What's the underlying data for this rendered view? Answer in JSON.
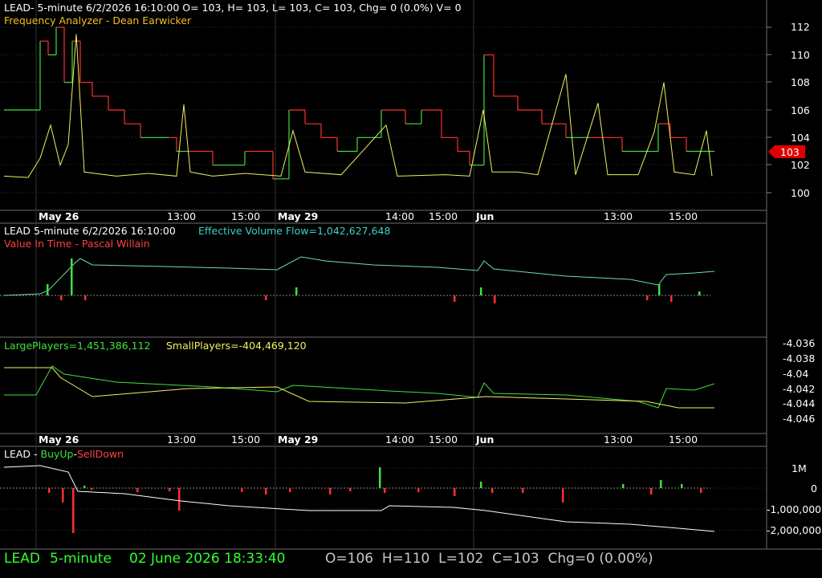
{
  "colors": {
    "background": "#000000",
    "frame": "#6e6e6e",
    "grid": "#3a3a3a",
    "text": "#ffffff",
    "title_orange": "#f0c020",
    "title_red": "#ff4040",
    "cyan": "#40d0c0",
    "green": "#40e040",
    "bright_green": "#30ff30",
    "red": "#ff3030",
    "yellow": "#f0f060",
    "mint": "#70e0a0",
    "marker_red": "#e00000"
  },
  "pane1": {
    "title": "LEAD- 5-minute 6/2/2026 16:10:00 O= 103, H= 103, L= 103, C= 103, Chg= 0 (0.0%) V= 0",
    "subtitle": "Frequency Analyzer - Dean Earwicker",
    "y_ticks": [
      "112",
      "110",
      "108",
      "106",
      "104",
      "102",
      "100"
    ],
    "last_price": "103"
  },
  "date_axis": {
    "labels": [
      "May 26",
      "13:00",
      "15:00",
      "May 29",
      "14:00",
      "15:00",
      "Jun",
      "13:00",
      "15:00"
    ]
  },
  "pane2": {
    "symbol": "LEAD 5-minute  6/2/2026 16:10:00",
    "indicator": "Effective Volume Flow=1,042,627,648",
    "subtitle": "Value In Time - Pascal Willain"
  },
  "pane3": {
    "large_players": "LargePlayers=1,451,386,112",
    "small_players": "SmallPlayers=-404,469,120",
    "y_ticks": [
      "-4.036",
      "-4.038",
      "-4.04",
      "-4.042",
      "-4.044",
      "-4.046"
    ]
  },
  "pane4": {
    "prefix": "LEAD - ",
    "buy": "BuyUp",
    "dash": "-",
    "sell": "SellDown",
    "y_ticks": [
      "1M",
      "0",
      "-1,000,000",
      "-2,000,000"
    ]
  },
  "status": {
    "symbol": "LEAD",
    "interval": "5-minute",
    "datetime": "02 June 2026 18:33:40",
    "quote": "O=106  H=110  L=102  C=103  Chg=0 (0.00%)"
  },
  "chart_data": {
    "type": "line",
    "x_sessions": [
      "May 26",
      "May 29",
      "Jun"
    ],
    "ylim_price": [
      99,
      113
    ],
    "price_series": [
      {
        "x": 0,
        "y": 106
      },
      {
        "x": 40,
        "y": 106
      },
      {
        "x": 45,
        "y": 111
      },
      {
        "x": 55,
        "y": 110
      },
      {
        "x": 65,
        "y": 112
      },
      {
        "x": 75,
        "y": 108
      },
      {
        "x": 85,
        "y": 111
      },
      {
        "x": 95,
        "y": 108
      },
      {
        "x": 110,
        "y": 107
      },
      {
        "x": 130,
        "y": 106
      },
      {
        "x": 150,
        "y": 105
      },
      {
        "x": 170,
        "y": 104
      },
      {
        "x": 190,
        "y": 104
      },
      {
        "x": 205,
        "y": 104
      },
      {
        "x": 215,
        "y": 103
      },
      {
        "x": 230,
        "y": 103
      },
      {
        "x": 260,
        "y": 102
      },
      {
        "x": 300,
        "y": 103
      },
      {
        "x": 335,
        "y": 101
      },
      {
        "x": 355,
        "y": 106
      },
      {
        "x": 375,
        "y": 105
      },
      {
        "x": 395,
        "y": 104
      },
      {
        "x": 415,
        "y": 103
      },
      {
        "x": 440,
        "y": 104
      },
      {
        "x": 470,
        "y": 106
      },
      {
        "x": 500,
        "y": 105
      },
      {
        "x": 520,
        "y": 106
      },
      {
        "x": 545,
        "y": 104
      },
      {
        "x": 565,
        "y": 103
      },
      {
        "x": 580,
        "y": 102
      },
      {
        "x": 598,
        "y": 110
      },
      {
        "x": 610,
        "y": 107
      },
      {
        "x": 640,
        "y": 106
      },
      {
        "x": 670,
        "y": 105
      },
      {
        "x": 700,
        "y": 104
      },
      {
        "x": 730,
        "y": 104
      },
      {
        "x": 770,
        "y": 103
      },
      {
        "x": 800,
        "y": 103
      },
      {
        "x": 815,
        "y": 105
      },
      {
        "x": 830,
        "y": 104
      },
      {
        "x": 850,
        "y": 103
      },
      {
        "x": 885,
        "y": 103
      }
    ],
    "frequency_series": [
      {
        "x": 0,
        "y": 101.2
      },
      {
        "x": 30,
        "y": 101.1
      },
      {
        "x": 45,
        "y": 102.5
      },
      {
        "x": 58,
        "y": 104.9
      },
      {
        "x": 70,
        "y": 102.0
      },
      {
        "x": 80,
        "y": 103.5
      },
      {
        "x": 90,
        "y": 111.5
      },
      {
        "x": 100,
        "y": 101.5
      },
      {
        "x": 140,
        "y": 101.2
      },
      {
        "x": 180,
        "y": 101.4
      },
      {
        "x": 215,
        "y": 101.2
      },
      {
        "x": 224,
        "y": 106.4
      },
      {
        "x": 232,
        "y": 101.5
      },
      {
        "x": 260,
        "y": 101.2
      },
      {
        "x": 300,
        "y": 101.4
      },
      {
        "x": 345,
        "y": 101.2
      },
      {
        "x": 360,
        "y": 104.5
      },
      {
        "x": 375,
        "y": 101.5
      },
      {
        "x": 420,
        "y": 101.3
      },
      {
        "x": 476,
        "y": 104.9
      },
      {
        "x": 490,
        "y": 101.2
      },
      {
        "x": 550,
        "y": 101.3
      },
      {
        "x": 580,
        "y": 101.2
      },
      {
        "x": 597,
        "y": 106.0
      },
      {
        "x": 608,
        "y": 101.5
      },
      {
        "x": 640,
        "y": 101.5
      },
      {
        "x": 665,
        "y": 101.3
      },
      {
        "x": 700,
        "y": 108.6
      },
      {
        "x": 712,
        "y": 101.3
      },
      {
        "x": 740,
        "y": 106.5
      },
      {
        "x": 752,
        "y": 101.3
      },
      {
        "x": 790,
        "y": 101.3
      },
      {
        "x": 810,
        "y": 104.4
      },
      {
        "x": 822,
        "y": 108.0
      },
      {
        "x": 835,
        "y": 101.5
      },
      {
        "x": 860,
        "y": 101.3
      },
      {
        "x": 875,
        "y": 104.5
      },
      {
        "x": 882,
        "y": 101.2
      }
    ],
    "effective_volume_flow": [
      {
        "x": 0,
        "y": 368
      },
      {
        "x": 45,
        "y": 366
      },
      {
        "x": 55,
        "y": 362
      },
      {
        "x": 88,
        "y": 328
      },
      {
        "x": 95,
        "y": 322
      },
      {
        "x": 110,
        "y": 330
      },
      {
        "x": 200,
        "y": 332
      },
      {
        "x": 280,
        "y": 334
      },
      {
        "x": 340,
        "y": 336
      },
      {
        "x": 370,
        "y": 320
      },
      {
        "x": 400,
        "y": 325
      },
      {
        "x": 460,
        "y": 330
      },
      {
        "x": 540,
        "y": 333
      },
      {
        "x": 590,
        "y": 337
      },
      {
        "x": 598,
        "y": 325
      },
      {
        "x": 610,
        "y": 335
      },
      {
        "x": 700,
        "y": 344
      },
      {
        "x": 780,
        "y": 348
      },
      {
        "x": 815,
        "y": 355
      },
      {
        "x": 825,
        "y": 342
      },
      {
        "x": 860,
        "y": 340
      },
      {
        "x": 885,
        "y": 338
      }
    ],
    "large_players": [
      {
        "x": 0,
        "y": 492
      },
      {
        "x": 40,
        "y": 492
      },
      {
        "x": 60,
        "y": 456
      },
      {
        "x": 75,
        "y": 466
      },
      {
        "x": 140,
        "y": 476
      },
      {
        "x": 260,
        "y": 482
      },
      {
        "x": 340,
        "y": 488
      },
      {
        "x": 360,
        "y": 480
      },
      {
        "x": 480,
        "y": 487
      },
      {
        "x": 540,
        "y": 490
      },
      {
        "x": 590,
        "y": 495
      },
      {
        "x": 598,
        "y": 477
      },
      {
        "x": 610,
        "y": 490
      },
      {
        "x": 700,
        "y": 492
      },
      {
        "x": 790,
        "y": 500
      },
      {
        "x": 815,
        "y": 508
      },
      {
        "x": 825,
        "y": 484
      },
      {
        "x": 860,
        "y": 486
      },
      {
        "x": 885,
        "y": 478
      }
    ],
    "small_players": [
      {
        "x": 0,
        "y": 458
      },
      {
        "x": 60,
        "y": 458
      },
      {
        "x": 70,
        "y": 470
      },
      {
        "x": 110,
        "y": 494
      },
      {
        "x": 230,
        "y": 484
      },
      {
        "x": 340,
        "y": 482
      },
      {
        "x": 380,
        "y": 500
      },
      {
        "x": 500,
        "y": 502
      },
      {
        "x": 600,
        "y": 494
      },
      {
        "x": 700,
        "y": 497
      },
      {
        "x": 800,
        "y": 500
      },
      {
        "x": 840,
        "y": 508
      },
      {
        "x": 885,
        "y": 508
      }
    ],
    "buyup_sell_line": [
      {
        "x": 0,
        "y": 582
      },
      {
        "x": 45,
        "y": 580
      },
      {
        "x": 80,
        "y": 588
      },
      {
        "x": 92,
        "y": 612
      },
      {
        "x": 150,
        "y": 615
      },
      {
        "x": 220,
        "y": 624
      },
      {
        "x": 280,
        "y": 630
      },
      {
        "x": 380,
        "y": 636
      },
      {
        "x": 470,
        "y": 636
      },
      {
        "x": 480,
        "y": 630
      },
      {
        "x": 560,
        "y": 632
      },
      {
        "x": 600,
        "y": 636
      },
      {
        "x": 700,
        "y": 650
      },
      {
        "x": 780,
        "y": 653
      },
      {
        "x": 840,
        "y": 658
      },
      {
        "x": 885,
        "y": 662
      }
    ]
  }
}
